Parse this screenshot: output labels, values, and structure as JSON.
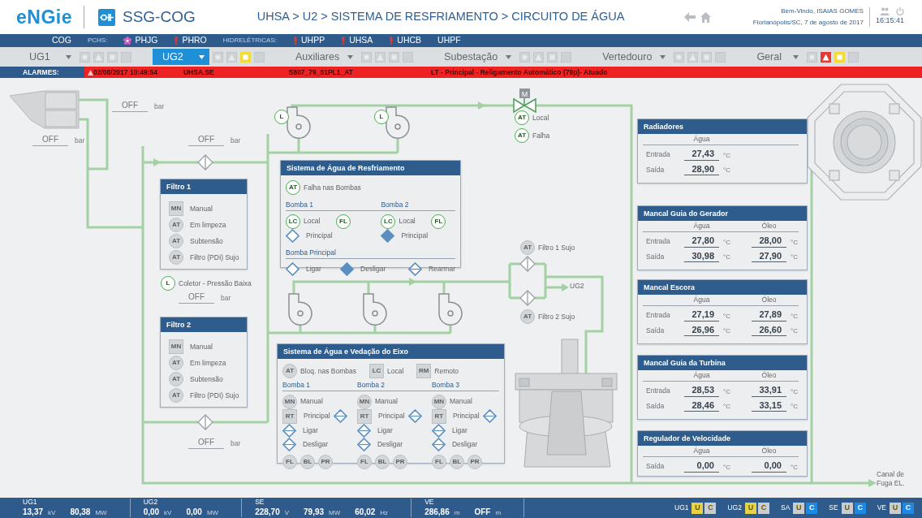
{
  "header": {
    "logo": "eNGie",
    "app_name": "SSG-COG",
    "breadcrumb": "UHSA > U2 > SISTEMA DE RESFRIAMENTO > CIRCUITO DE ÁGUA",
    "welcome": "Bem-Vindo, ISAIAS GOMES",
    "location_date": "Florianópolis/SC, 7 de agosto de 2017",
    "time": "16:15:41"
  },
  "plant_nav": [
    {
      "kind": "link",
      "label": "COG"
    },
    {
      "kind": "heading",
      "label": "PCHS:"
    },
    {
      "kind": "flagged",
      "label": "PHJG",
      "color": "#e05cc8"
    },
    {
      "kind": "alarm",
      "label": "PHRO",
      "color": "#e53935"
    },
    {
      "kind": "heading",
      "label": "HIDRELÉTRICAS:"
    },
    {
      "kind": "alarm",
      "label": "UHPP",
      "color": "#e53935"
    },
    {
      "kind": "alarm",
      "label": "UHSA",
      "color": "#e53935"
    },
    {
      "kind": "alarm",
      "label": "UHCB",
      "color": "#e53935"
    },
    {
      "kind": "plain",
      "label": "UHPF"
    }
  ],
  "unit_tabs": [
    {
      "label": "UG1",
      "selected": false,
      "alarm": false,
      "warning": false
    },
    {
      "label": "UG2",
      "selected": true,
      "alarm": false,
      "warning": true
    },
    {
      "label": "Auxiliares",
      "selected": false,
      "alarm": false,
      "warning": false
    },
    {
      "label": "Subestação",
      "selected": false,
      "alarm": false,
      "warning": false
    },
    {
      "label": "Vertedouro",
      "selected": false,
      "alarm": false,
      "warning": false
    },
    {
      "label": "Geral",
      "selected": false,
      "alarm": true,
      "warning": true
    }
  ],
  "alarm_bar": {
    "label": "ALARMES:",
    "date": "02/08/2017 10:49:54",
    "source": "UHSA.SE",
    "tag": "S807_79_01PL1_AT",
    "description": "LT - Principal - Religamento Automático (79p)- Atuado"
  },
  "diagram": {
    "pressure_readings": [
      {
        "value": "OFF",
        "unit": "bar"
      },
      {
        "value": "OFF",
        "unit": "bar"
      },
      {
        "value": "OFF",
        "unit": "bar"
      },
      {
        "value": "OFF",
        "unit": "bar"
      },
      {
        "value": "OFF",
        "unit": "bar"
      }
    ],
    "pump_indicators": [
      {
        "code": "L",
        "kind": "circle",
        "active": true
      },
      {
        "code": "L",
        "kind": "circle",
        "active": true
      }
    ],
    "valve": {
      "label": "M",
      "indicators": [
        {
          "code": "AT",
          "kind": "circle",
          "active": true,
          "label": "Local"
        },
        {
          "code": "AT",
          "kind": "circle",
          "active": true,
          "label": "Falha"
        }
      ]
    },
    "filters": [
      {
        "title": "Filtro 1",
        "indicators": [
          {
            "code": "MN",
            "kind": "square",
            "active": false,
            "label": "Manual"
          },
          {
            "code": "AT",
            "kind": "circle",
            "active": false,
            "label": "Em limpeza"
          },
          {
            "code": "AT",
            "kind": "circle",
            "active": false,
            "label": "Subtensão"
          },
          {
            "code": "AT",
            "kind": "circle",
            "active": false,
            "label": "Filtro (PDI) Sujo"
          }
        ]
      },
      {
        "title": "Filtro 2",
        "indicators": [
          {
            "code": "MN",
            "kind": "square",
            "active": false,
            "label": "Manual"
          },
          {
            "code": "AT",
            "kind": "circle",
            "active": false,
            "label": "Em limpeza"
          },
          {
            "code": "AT",
            "kind": "circle",
            "active": false,
            "label": "Subtensão"
          },
          {
            "code": "AT",
            "kind": "circle",
            "active": false,
            "label": "Filtro (PDI) Sujo"
          }
        ]
      }
    ],
    "collector": {
      "code": "L",
      "kind": "circle",
      "active": true,
      "label": "Coletor - Pressão Baixa"
    },
    "cooling_panel": {
      "title": "Sistema de Água de Resfriamento",
      "alarm": {
        "code": "AT",
        "kind": "circle",
        "active": true,
        "label": "Falha nas Bombas"
      },
      "pumps": [
        {
          "title": "Bomba 1",
          "local": {
            "code": "LC",
            "kind": "circle",
            "active": true,
            "label": "Local"
          },
          "fault": {
            "code": "FL",
            "kind": "circle",
            "active": true
          },
          "main": {
            "label": "Principal",
            "filled": false,
            "line": false
          }
        },
        {
          "title": "Bomba 2",
          "local": {
            "code": "LC",
            "kind": "circle",
            "active": true,
            "label": "Local"
          },
          "fault": {
            "code": "FL",
            "kind": "circle",
            "active": true
          },
          "main": {
            "label": "Principal",
            "filled": true,
            "line": false
          }
        }
      ],
      "main_pump": {
        "title": "Bomba Principal",
        "commands": [
          {
            "label": "Ligar",
            "filled": false,
            "line": false
          },
          {
            "label": "Desligar",
            "filled": true,
            "line": false
          },
          {
            "label": "Rearmar",
            "filled": false,
            "line": true
          }
        ]
      }
    },
    "filter_alarms": [
      {
        "code": "AT",
        "kind": "circle",
        "active": false,
        "label": "Filtro 1 Sujo"
      },
      {
        "code": "AT",
        "kind": "circle",
        "active": false,
        "label": "Filtro 2 Sujo"
      }
    ],
    "outlet_label": "UG2",
    "shaft_panel": {
      "title": "Sistema de Água e Vedação do Eixo",
      "indicators": [
        {
          "code": "AT",
          "kind": "circle",
          "active": false,
          "label": "Bloq. nas Bombas"
        },
        {
          "code": "LC",
          "kind": "square",
          "active": false,
          "label": "Local"
        },
        {
          "code": "RM",
          "kind": "square",
          "active": false,
          "label": "Remoto"
        }
      ],
      "pumps": [
        {
          "title": "Bomba 1",
          "mode": {
            "code": "MN",
            "kind": "circle",
            "active": false,
            "label": "Manual"
          },
          "main": {
            "code": "RT",
            "kind": "square",
            "active": false,
            "label": "Principal",
            "filled": false,
            "line": true
          },
          "commands": [
            {
              "label": "Ligar",
              "filled": false,
              "line": true
            },
            {
              "label": "Desligar",
              "filled": false,
              "line": true
            }
          ],
          "flags": [
            {
              "code": "FL",
              "kind": "circle",
              "active": false
            },
            {
              "code": "BL",
              "kind": "circle",
              "active": false
            },
            {
              "code": "PR",
              "kind": "circle",
              "active": false
            }
          ]
        },
        {
          "title": "Bomba 2",
          "mode": {
            "code": "MN",
            "kind": "circle",
            "active": false,
            "label": "Manual"
          },
          "main": {
            "code": "RT",
            "kind": "square",
            "active": false,
            "label": "Principal",
            "filled": false,
            "line": true
          },
          "commands": [
            {
              "label": "Ligar",
              "filled": false,
              "line": true
            },
            {
              "label": "Desligar",
              "filled": false,
              "line": true
            }
          ],
          "flags": [
            {
              "code": "FL",
              "kind": "circle",
              "active": false
            },
            {
              "code": "BL",
              "kind": "circle",
              "active": false
            },
            {
              "code": "PR",
              "kind": "circle",
              "active": false
            }
          ]
        },
        {
          "title": "Bomba 3",
          "mode": {
            "code": "MN",
            "kind": "circle",
            "active": false,
            "label": "Manual"
          },
          "main": {
            "code": "RT",
            "kind": "square",
            "active": false,
            "label": "Principal",
            "filled": false,
            "line": true
          },
          "commands": [
            {
              "label": "Ligar",
              "filled": false,
              "line": true
            },
            {
              "label": "Desligar",
              "filled": false,
              "line": true
            }
          ],
          "flags": [
            {
              "code": "FL",
              "kind": "circle",
              "active": false
            },
            {
              "code": "BL",
              "kind": "circle",
              "active": false
            },
            {
              "code": "PR",
              "kind": "circle",
              "active": false
            }
          ]
        }
      ]
    },
    "temperature_panels": [
      {
        "title": "Radiadores",
        "columns": [
          "Água"
        ],
        "rows": [
          {
            "label": "Entrada",
            "values": [
              {
                "value": "27,43",
                "unit": "°C"
              }
            ]
          },
          {
            "label": "Saída",
            "values": [
              {
                "value": "28,90",
                "unit": "°C"
              }
            ]
          }
        ]
      },
      {
        "title": "Mancal Guia do Gerador",
        "columns": [
          "Água",
          "Óleo"
        ],
        "rows": [
          {
            "label": "Entrada",
            "values": [
              {
                "value": "27,80",
                "unit": "°C"
              },
              {
                "value": "28,00",
                "unit": "°C"
              }
            ]
          },
          {
            "label": "Saída",
            "values": [
              {
                "value": "30,98",
                "unit": "°C"
              },
              {
                "value": "27,90",
                "unit": "°C"
              }
            ]
          }
        ]
      },
      {
        "title": "Mancal Escora",
        "columns": [
          "Água",
          "Óleo"
        ],
        "rows": [
          {
            "label": "Entrada",
            "values": [
              {
                "value": "27,19",
                "unit": "°C"
              },
              {
                "value": "27,89",
                "unit": "°C"
              }
            ]
          },
          {
            "label": "Saída",
            "values": [
              {
                "value": "26,96",
                "unit": "°C"
              },
              {
                "value": "26,60",
                "unit": "°C"
              }
            ]
          }
        ]
      },
      {
        "title": "Mancal Guia da Turbina",
        "columns": [
          "Água",
          "Óleo"
        ],
        "rows": [
          {
            "label": "Entrada",
            "values": [
              {
                "value": "28,53",
                "unit": "°C"
              },
              {
                "value": "33,91",
                "unit": "°C"
              }
            ]
          },
          {
            "label": "Saída",
            "values": [
              {
                "value": "28,46",
                "unit": "°C"
              },
              {
                "value": "33,15",
                "unit": "°C"
              }
            ]
          }
        ]
      },
      {
        "title": "Regulador de Velocidade",
        "columns": [
          "Água",
          "Óleo"
        ],
        "rows": [
          {
            "label": "Saída",
            "values": [
              {
                "value": "0,00",
                "unit": "°C"
              },
              {
                "value": "0,00",
                "unit": "°C"
              }
            ]
          }
        ]
      }
    ],
    "drain_label": "Canal de Fuga EL."
  },
  "status_bar": {
    "groups": [
      {
        "title": "UG1",
        "readings": [
          {
            "value": "13,37",
            "unit": "kV"
          },
          {
            "value": "80,38",
            "unit": "MW"
          }
        ]
      },
      {
        "title": "UG2",
        "readings": [
          {
            "value": "0,00",
            "unit": "kV"
          },
          {
            "value": "0,00",
            "unit": "MW"
          }
        ]
      },
      {
        "title": "SE",
        "readings": [
          {
            "value": "228,70",
            "unit": "V"
          },
          {
            "value": "79,93",
            "unit": "MW"
          },
          {
            "value": "60,02",
            "unit": "Hz"
          }
        ]
      },
      {
        "title": "VE",
        "readings": [
          {
            "value": "286,86",
            "unit": "m"
          },
          {
            "value": "OFF",
            "unit": "m"
          }
        ]
      }
    ],
    "modes": [
      {
        "label": "UG1",
        "boxes": [
          {
            "text": "U",
            "color": "#e6d24a"
          },
          {
            "text": "C",
            "color": "#c9ccd0"
          }
        ]
      },
      {
        "label": "UG2",
        "boxes": [
          {
            "text": "U",
            "color": "#e6d24a"
          },
          {
            "text": "C",
            "color": "#c9ccd0"
          }
        ]
      },
      {
        "label": "SA",
        "boxes": [
          {
            "text": "U",
            "color": "#c9ccd0"
          },
          {
            "text": "C",
            "color": "#1e88e5"
          }
        ]
      },
      {
        "label": "SE",
        "boxes": [
          {
            "text": "U",
            "color": "#c9ccd0"
          },
          {
            "text": "C",
            "color": "#1e88e5"
          }
        ]
      },
      {
        "label": "VE",
        "boxes": [
          {
            "text": "U",
            "color": "#c9ccd0"
          },
          {
            "text": "C",
            "color": "#1e88e5"
          }
        ]
      }
    ]
  }
}
